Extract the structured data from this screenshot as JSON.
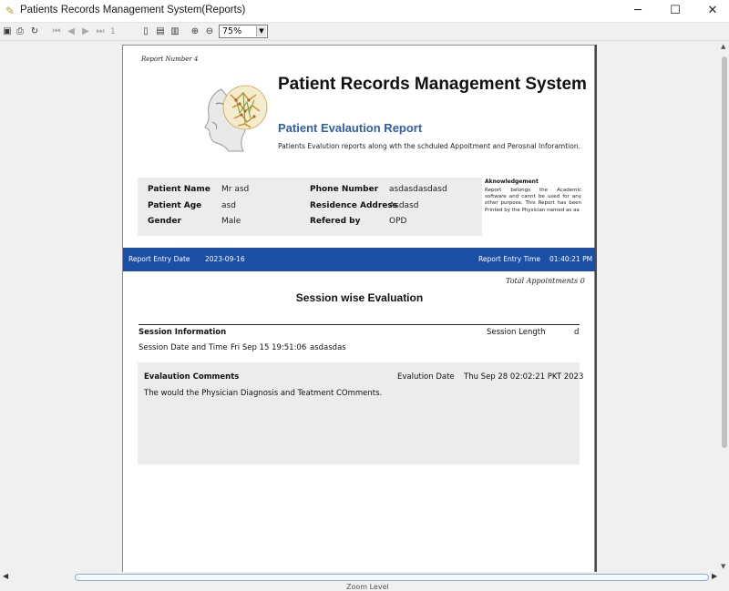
{
  "window": {
    "title": "Patients Records Management System(Reports)",
    "min_glyph": "─",
    "max_glyph": "☐",
    "close_glyph": "✕"
  },
  "toolbar": {
    "page_number": "1",
    "zoom_value": "75%",
    "zoom_options": [
      "75%"
    ]
  },
  "report": {
    "report_number": "Report Number 4",
    "title": "Patient Records Management System",
    "subtitle": "Patient Evalaution Report",
    "description": "Patients Evalution reports along wth the schduled Appoitment and Perosnal Inforamtion.",
    "patient": {
      "name_label": "Patient Name",
      "name_value": "Mr asd",
      "age_label": "Patient Age",
      "age_value": "asd",
      "gender_label": "Gender",
      "gender_value": "Male",
      "phone_label": "Phone Number",
      "phone_value": "asdasdasdasd",
      "address_label": "Residence Address",
      "address_value": "Asdasd",
      "referred_label": "Refered by",
      "referred_value": "OPD"
    },
    "acknowledgement": {
      "title": "Aknowledgement",
      "text": "Report belongs the Academic software and cannt be used for any other purpose. This Report has been Printed by the Physician named as aa"
    },
    "entry": {
      "date_label": "Report Entry Date",
      "date_value": "2023-09-16",
      "time_label": "Report Entry Time",
      "time_value": "01:40:21 PM"
    },
    "total_appointments": "Total Appointments  0",
    "section_title": "Session wise Evaluation",
    "session": {
      "info_label": "Session Information",
      "length_label": "Session Length",
      "length_value": "d",
      "datetime_label": "Session Date and Time",
      "datetime_value": "Fri Sep 15 19:51:06",
      "extra_value": "asdasdas"
    },
    "evaluation": {
      "comments_label": "Evalaution Comments",
      "date_label": "Evalution Date",
      "date_value": "Thu Sep 28 02:02:21 PKT 2023",
      "comment_text": "The would the Physician Diagnosis and Teatment COmments."
    }
  },
  "statusbar": {
    "text": "Zoom Level"
  },
  "colors": {
    "accent_blue": "#1b4fa6",
    "subtitle_blue": "#2e5fa8",
    "panel_gray": "#ececec"
  }
}
